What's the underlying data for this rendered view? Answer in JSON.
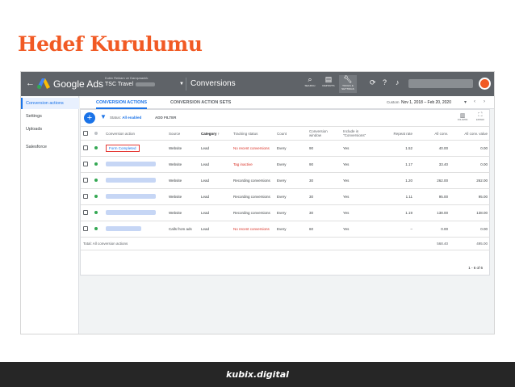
{
  "slide": {
    "title": "Hedef Kurulumu",
    "footer_brand": "kubix.digital"
  },
  "colors": {
    "title_orange": "#f15a24",
    "topbar": "#5f6368",
    "accent_blue": "#1a73e8",
    "warning_red": "#d93025",
    "highlight_box": "#e53935"
  },
  "topbar": {
    "back_icon": "arrow-left-icon",
    "brand": "Google Ads",
    "account_subtitle": "Kubix Reklam ve Danışmanlık",
    "account_name": "TSC Travel",
    "page_name": "Conversions",
    "tools": [
      {
        "icon": "search-icon",
        "label": "SEARCH"
      },
      {
        "icon": "reports-icon",
        "label": "REPORTS"
      },
      {
        "icon": "wrench-icon",
        "label": "TOOLS & SETTINGS"
      }
    ]
  },
  "leftnav": {
    "items": [
      "Conversion actions",
      "Settings",
      "Uploads",
      "Salesforce"
    ]
  },
  "tabs": [
    "CONVERSION ACTIONS",
    "CONVERSION ACTION SETS"
  ],
  "date_range": {
    "label": "Custom",
    "value": "Nov 1, 2018 – Feb 20, 2020"
  },
  "toolbar": {
    "status_prefix": "Status:",
    "status_value": "All enabled",
    "add_filter": "ADD FILTER",
    "columns": "COLUMNS",
    "expand": "EXPAND"
  },
  "table": {
    "headers": [
      "Conversion action",
      "Source",
      "Category",
      "Tracking status",
      "Count",
      "Conversion window",
      "Include in \"Conversions\"",
      "Repeat rate",
      "All conv.",
      "All conv. value"
    ],
    "rows": [
      {
        "name": "Form Completed",
        "source": "Website",
        "category": "Lead",
        "tracking": "No recent conversions",
        "count": "Every",
        "window": "90",
        "include": "Yes",
        "repeat": "1.52",
        "allconv": "40.00",
        "value": "0.00"
      },
      {
        "name": "",
        "source": "Website",
        "category": "Lead",
        "tracking": "Tag inactive",
        "count": "Every",
        "window": "90",
        "include": "Yes",
        "repeat": "1.17",
        "allconv": "33.40",
        "value": "0.00"
      },
      {
        "name": "",
        "source": "Website",
        "category": "Lead",
        "tracking": "Recording conversions",
        "count": "Every",
        "window": "30",
        "include": "Yes",
        "repeat": "1.20",
        "allconv": "262.00",
        "value": "262.00"
      },
      {
        "name": "",
        "source": "Website",
        "category": "Lead",
        "tracking": "Recording conversions",
        "count": "Every",
        "window": "30",
        "include": "Yes",
        "repeat": "1.11",
        "allconv": "95.00",
        "value": "95.00"
      },
      {
        "name": "",
        "source": "Website",
        "category": "Lead",
        "tracking": "Recording conversions",
        "count": "Every",
        "window": "30",
        "include": "Yes",
        "repeat": "1.19",
        "allconv": "138.00",
        "value": "138.00"
      },
      {
        "name": "",
        "source": "Calls from ads",
        "category": "Lead",
        "tracking": "No recent conversions",
        "count": "Every",
        "window": "60",
        "include": "Yes",
        "repeat": "–",
        "allconv": "0.00",
        "value": "0.00"
      }
    ],
    "total": {
      "label": "Total: All conversion actions",
      "allconv": "568.40",
      "value": "495.00"
    },
    "pager": "1 - 6 of 6"
  }
}
